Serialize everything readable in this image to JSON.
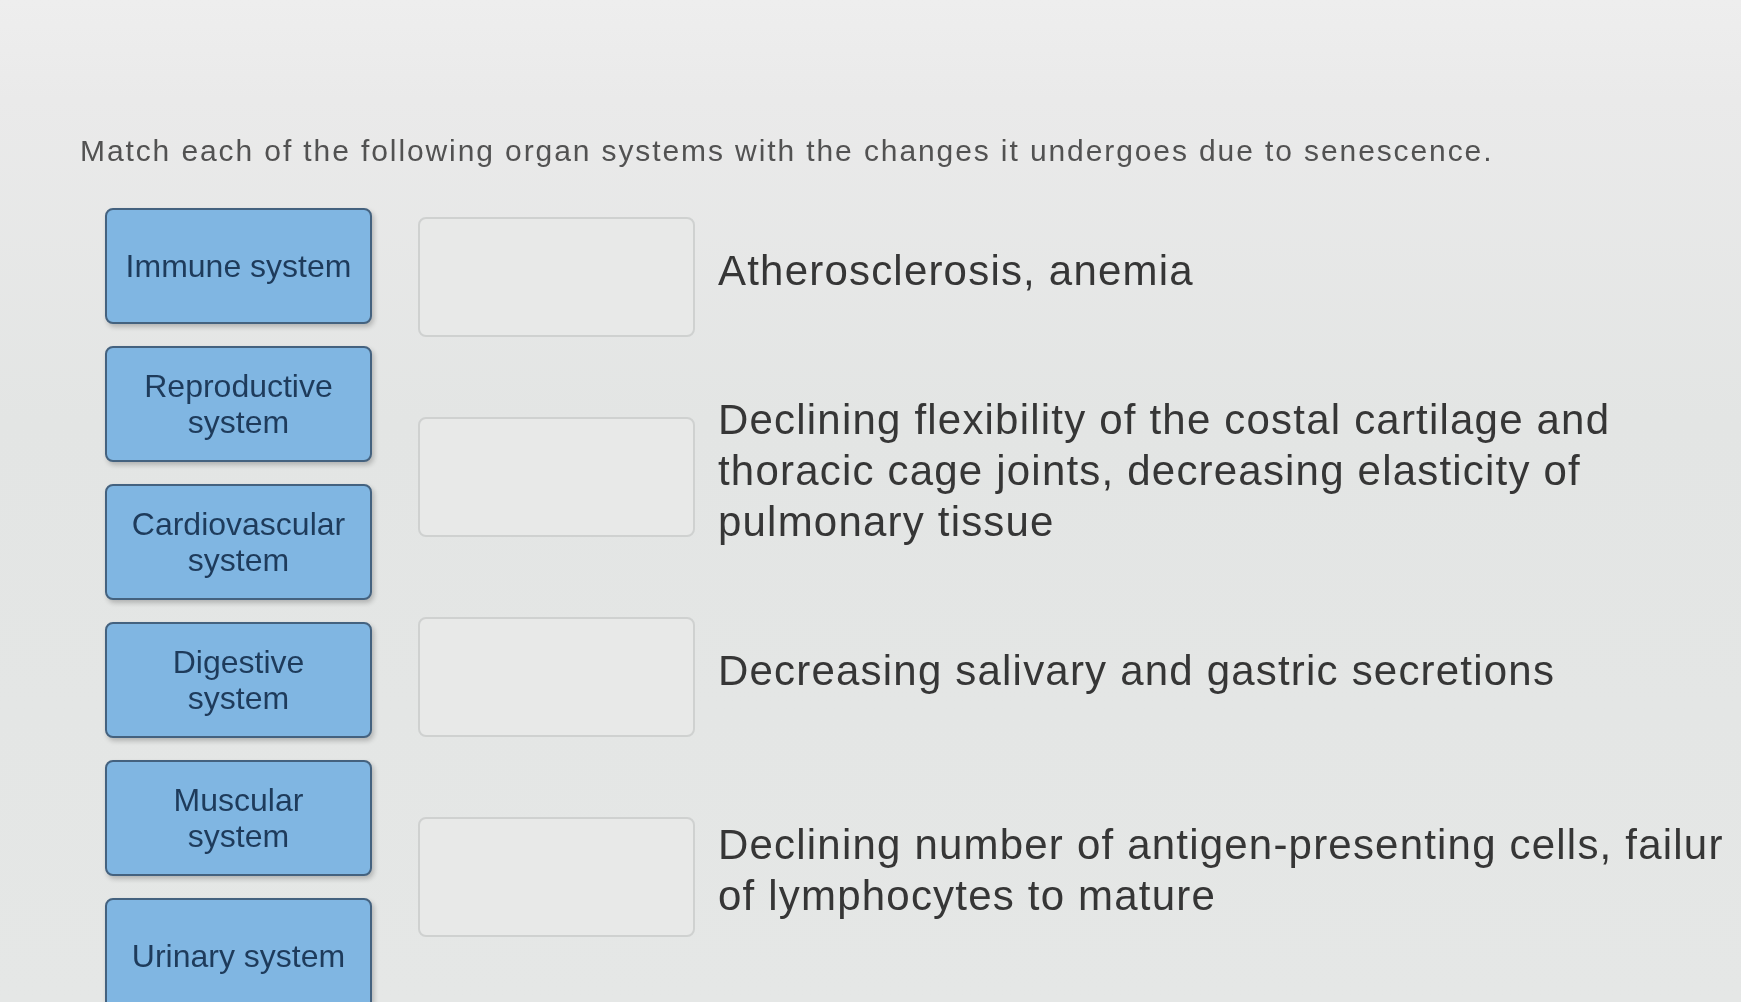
{
  "prompt": "Match each of the following organ systems with the changes it undergoes due to senescence.",
  "choices": [
    {
      "lines": [
        "Immune system"
      ]
    },
    {
      "lines": [
        "Reproductive",
        "system"
      ]
    },
    {
      "lines": [
        "Cardiovascular",
        "system"
      ]
    },
    {
      "lines": [
        "Digestive",
        "system"
      ]
    },
    {
      "lines": [
        "Muscular",
        "system"
      ]
    },
    {
      "lines": [
        "Urinary system"
      ]
    }
  ],
  "matches": [
    {
      "lines": [
        "Atherosclerosis, anemia"
      ]
    },
    {
      "lines": [
        "Declining flexibility of the costal cartilage and",
        "thoracic cage joints, decreasing elasticity of",
        "pulmonary tissue"
      ]
    },
    {
      "lines": [
        "Decreasing salivary and gastric secretions"
      ]
    },
    {
      "lines": [
        "Declining number of antigen-presenting cells, failur",
        "of lymphocytes to mature"
      ]
    }
  ]
}
